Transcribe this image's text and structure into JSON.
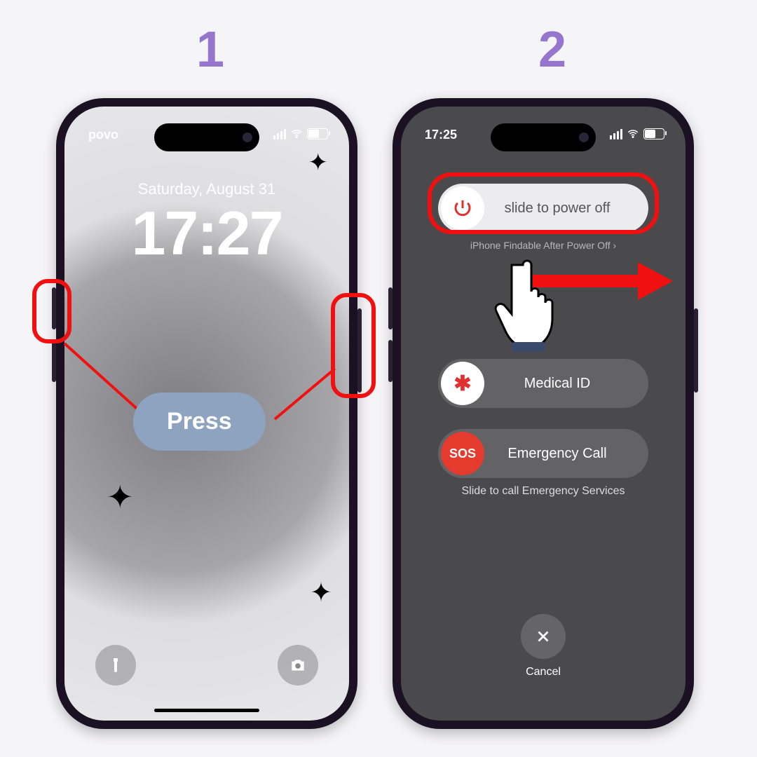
{
  "steps": {
    "one": "1",
    "two": "2"
  },
  "annotation": {
    "press": "Press"
  },
  "phone1": {
    "carrier": "povo",
    "date": "Saturday, August 31",
    "time": "17:27"
  },
  "phone2": {
    "time": "17:25",
    "power_slider": "slide to power off",
    "findable": "iPhone Findable After Power Off",
    "medical": "Medical ID",
    "medical_icon": "✱",
    "sos": "Emergency Call",
    "sos_icon": "SOS",
    "sos_hint": "Slide to call Emergency Services",
    "cancel": "Cancel"
  },
  "colors": {
    "step_number": "#9575cd",
    "highlight": "#f01010",
    "press_pill": "#8ea3c0"
  }
}
